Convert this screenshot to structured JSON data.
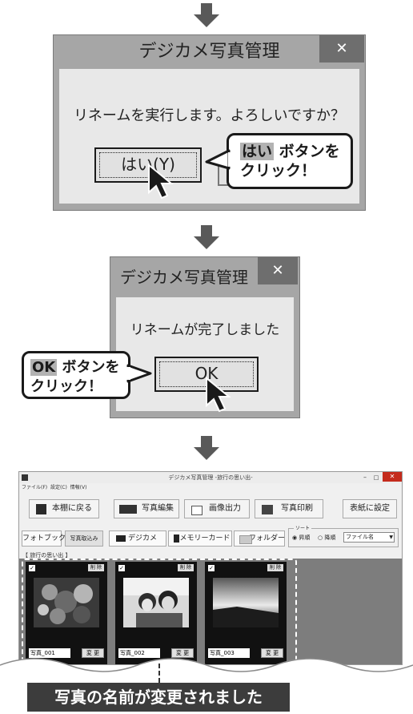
{
  "dialog1": {
    "title": "デジカメ写真管理",
    "close": "✕",
    "message": "リネームを実行します。よろしいですか？",
    "yes_button": "はい(Y)",
    "callout_highlight": "はい",
    "callout_line1": "ボタンを",
    "callout_line2": "クリック！"
  },
  "dialog2": {
    "title": "デジカメ写真管理",
    "close": "✕",
    "message": "リネームが完了しました",
    "ok_button": "OK",
    "callout_highlight": "OK",
    "callout_line1": "ボタンを",
    "callout_line2": "クリック！"
  },
  "app": {
    "title": "デジカメ写真管理 -旅行の思い出-",
    "menu": [
      "ファイル(F)",
      "設定(C)",
      "情報(V)"
    ],
    "toolbar": {
      "back": "本棚に戻る",
      "edit": "写真編集",
      "export": "画像出力",
      "print": "写真印刷",
      "cover": "表紙に設定"
    },
    "tabs": {
      "photobook": "フォトブック",
      "import": "写真取込み",
      "camera": "デジカメ",
      "memory": "メモリーカード",
      "folder": "フォルダー"
    },
    "sort": {
      "label": "ソート",
      "asc": "昇順",
      "desc": "降順",
      "field": "ファイル名"
    },
    "album": "【 旅行の思い出 】",
    "photos": [
      {
        "name": "写真_001",
        "change": "変 更",
        "delete": "削 除"
      },
      {
        "name": "写真_002",
        "change": "変 更",
        "delete": "削 除"
      },
      {
        "name": "写真_003",
        "change": "変 更",
        "delete": "削 除"
      }
    ]
  },
  "caption": "写真の名前が変更されました"
}
